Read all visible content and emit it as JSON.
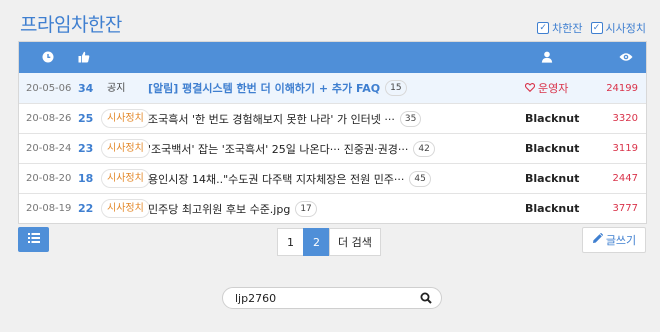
{
  "board_title": "프라임차한잔",
  "filters": [
    {
      "label": "차한잔",
      "checked": true
    },
    {
      "label": "시사정치",
      "checked": true
    }
  ],
  "header_icons": [
    "clock-icon",
    "thumbs-up-icon",
    "user-icon",
    "eye-icon"
  ],
  "rows": [
    {
      "date": "20-05-06",
      "likes": "34",
      "tag": "공지",
      "title": "[알림] 평결시스템 한번 더 이해하기 + 추가 FAQ",
      "comments": "15",
      "author": "운영자",
      "views": "24199"
    },
    {
      "date": "20-08-26",
      "likes": "25",
      "tag": "시사정치",
      "title": "조국흑서 '한 번도 경험해보지 못한 나라' 가 인터넷 ···",
      "comments": "35",
      "author": "Blacknut",
      "views": "3320"
    },
    {
      "date": "20-08-24",
      "likes": "23",
      "tag": "시사정치",
      "title": "'조국백서' 잡는 '조국흑서' 25일 나온다··· 진중권·권경···",
      "comments": "42",
      "author": "Blacknut",
      "views": "3119"
    },
    {
      "date": "20-08-20",
      "likes": "18",
      "tag": "시사정치",
      "title": "용인시장 14채..\"수도권 다주택 지자체장은 전원 민주···",
      "comments": "45",
      "author": "Blacknut",
      "views": "2447"
    },
    {
      "date": "20-08-19",
      "likes": "22",
      "tag": "시사정치",
      "title": "민주당 최고위원 후보 수준.jpg",
      "comments": "17",
      "author": "Blacknut",
      "views": "3777"
    }
  ],
  "pagination": {
    "pages": [
      "1",
      "2"
    ],
    "current": "2",
    "more_label": "더 검색"
  },
  "write_label": "글쓰기",
  "search": {
    "value": "ljp2760"
  },
  "colors": {
    "accent": "#4f8fd8",
    "link": "#3f7fd0",
    "category": "#e48a2c",
    "views": "#d9334a"
  }
}
